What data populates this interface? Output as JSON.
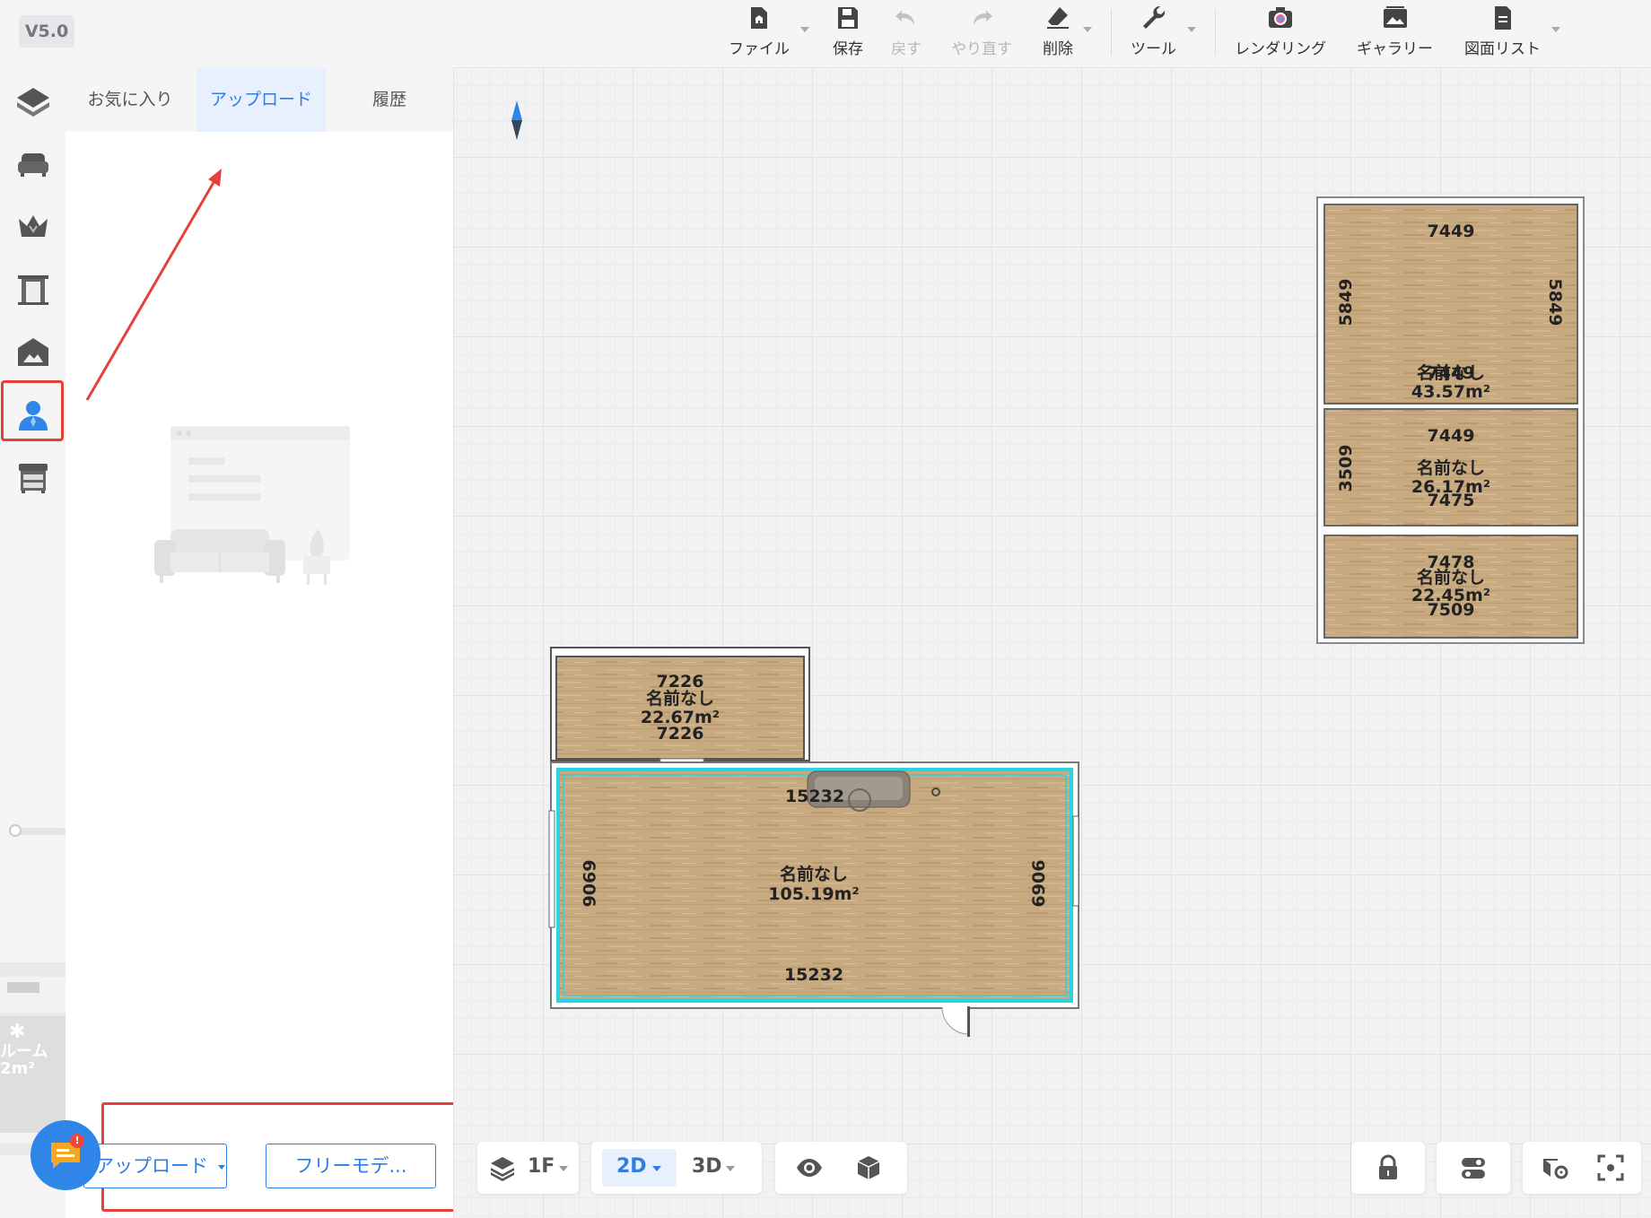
{
  "app": {
    "version": "V5.0"
  },
  "toolbar": {
    "file": "ファイル",
    "save": "保存",
    "undo": "戻す",
    "redo": "やり直す",
    "delete": "削除",
    "tools": "ツール",
    "rendering": "レンダリング",
    "gallery": "ギャラリー",
    "drawing_list": "図面リスト"
  },
  "sidebar": {
    "rail_items": [
      "floorplan-icon",
      "sofa-icon",
      "crown-icon",
      "door-icon",
      "landscape-icon",
      "user-icon",
      "cabinet-icon"
    ],
    "active_item": "user-icon",
    "minimap": {
      "room_label": "ルーム",
      "area": "2m²"
    }
  },
  "panel": {
    "tabs": [
      {
        "label": "お気に入り"
      },
      {
        "label": "アップロード"
      },
      {
        "label": "履歴"
      }
    ],
    "active_tab": "アップロード",
    "upload_button": "アップロード",
    "free_model_button": "フリーモデ..."
  },
  "rooms": [
    {
      "top_dim": "7449",
      "left_dim": "5849",
      "right_dim": "5849",
      "name": "名前なし",
      "name_overlap_dim": "7449",
      "area": "43.57m²"
    },
    {
      "top_dim": "7449",
      "left_dim": "3509",
      "name": "名前なし",
      "area": "26.17m²",
      "bottom_dim": "7475"
    },
    {
      "top_dim": "7478",
      "name": "名前なし",
      "area": "22.45m²",
      "bottom_dim": "7509"
    },
    {
      "top_dim": "7226",
      "name": "名前なし",
      "area": "22.67m²",
      "bottom_dim": "7226"
    },
    {
      "top_dim": "15232",
      "left_dim": "6906",
      "right_dim": "6906",
      "name": "名前なし",
      "area": "105.19m²",
      "bottom_dim": "15232"
    }
  ],
  "bottombar": {
    "floor": "1F",
    "view_2d": "2D",
    "view_3d": "3D",
    "active_view": "2D"
  },
  "colors": {
    "accent": "#2f7de1",
    "highlight_red": "#e5413a",
    "selection_cyan": "#2ad3e0",
    "wood": "#c8a97f"
  }
}
